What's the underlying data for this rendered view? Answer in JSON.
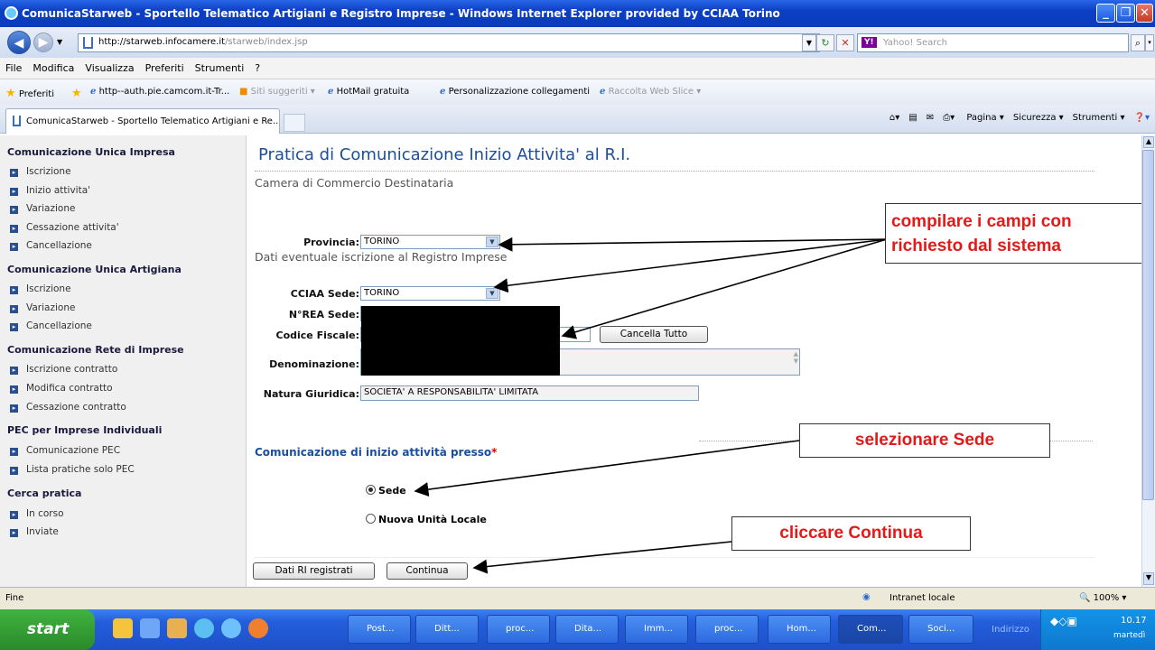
{
  "window": {
    "title": "ComunicaStarweb - Sportello Telematico Artigiani e Registro Imprese - Windows Internet Explorer provided by CCIAA Torino"
  },
  "addressbar": {
    "url_host": "http://starweb.infocamere.it",
    "url_path": "/starweb/index.jsp",
    "search_placeholder": "Yahoo! Search"
  },
  "menu": [
    "File",
    "Modifica",
    "Visualizza",
    "Preferiti",
    "Strumenti",
    "?"
  ],
  "favorites": {
    "label": "Preferiti",
    "items": [
      "http--auth.pie.camcom.it-Tr...",
      "Siti suggeriti ▾",
      "HotMail gratuita",
      "Personalizzazione collegamenti",
      "Raccolta Web Slice ▾"
    ]
  },
  "tab": {
    "label": "ComunicaStarweb - Sportello Telematico Artigiani e Re..."
  },
  "commandbar": [
    "Pagina ▾",
    "Sicurezza ▾",
    "Strumenti ▾"
  ],
  "sidebar": {
    "sections": [
      {
        "title": "Comunicazione Unica Impresa",
        "items": [
          "Iscrizione",
          "Inizio attivita'",
          "Variazione",
          "Cessazione attivita'",
          "Cancellazione"
        ]
      },
      {
        "title": "Comunicazione Unica Artigiana",
        "items": [
          "Iscrizione",
          "Variazione",
          "Cancellazione"
        ]
      },
      {
        "title": "Comunicazione Rete di Imprese",
        "items": [
          "Iscrizione contratto",
          "Modifica contratto",
          "Cessazione contratto"
        ]
      },
      {
        "title": "PEC per Imprese Individuali",
        "items": [
          "Comunicazione PEC",
          "Lista pratiche solo PEC"
        ]
      },
      {
        "title": "Cerca pratica",
        "items": [
          "In corso",
          "Inviate"
        ]
      }
    ]
  },
  "main": {
    "title": "Pratica di Comunicazione Inizio Attivita' al R.I.",
    "section1": "Camera di Commercio Destinataria",
    "provincia_label": "Provincia:",
    "provincia_value": "TORINO",
    "section2": "Dati eventuale iscrizione al Registro Imprese",
    "cciaa_label": "CCIAA Sede:",
    "cciaa_value": "TORINO",
    "nrea_label": "N°REA Sede:",
    "cf_label": "Codice Fiscale:",
    "cancella_button": "Cancella Tutto",
    "denominazione_label": "Denominazione:",
    "natura_label": "Natura Giuridica:",
    "natura_value": "SOCIETA' A RESPONSABILITA' LIMITATA",
    "section3": "Comunicazione di inizio attività presso",
    "required_mark": "*",
    "radio_sede": "Sede",
    "radio_nuova": "Nuova Unità Locale",
    "btn_dati": "Dati RI registrati",
    "btn_continua": "Continua"
  },
  "annotations": {
    "compila_line1": "compilare i campi con",
    "compila_line2": "richiesto dal sistema",
    "seleziona": "selezionare Sede",
    "clicca": "cliccare Continua",
    "arrow_color": "#000000",
    "text_color": "#e41a1a"
  },
  "status": {
    "left": "Fine",
    "zone": "Intranet locale",
    "zoom": "100%"
  },
  "taskbar": {
    "start": "start",
    "items": [
      "Post...",
      "Ditt...",
      "proc...",
      "Dita...",
      "Imm...",
      "proc...",
      "Hom...",
      "Com...",
      "Soci..."
    ],
    "address_label": "Indirizzo",
    "clock": "10.17",
    "day": "martedì"
  }
}
